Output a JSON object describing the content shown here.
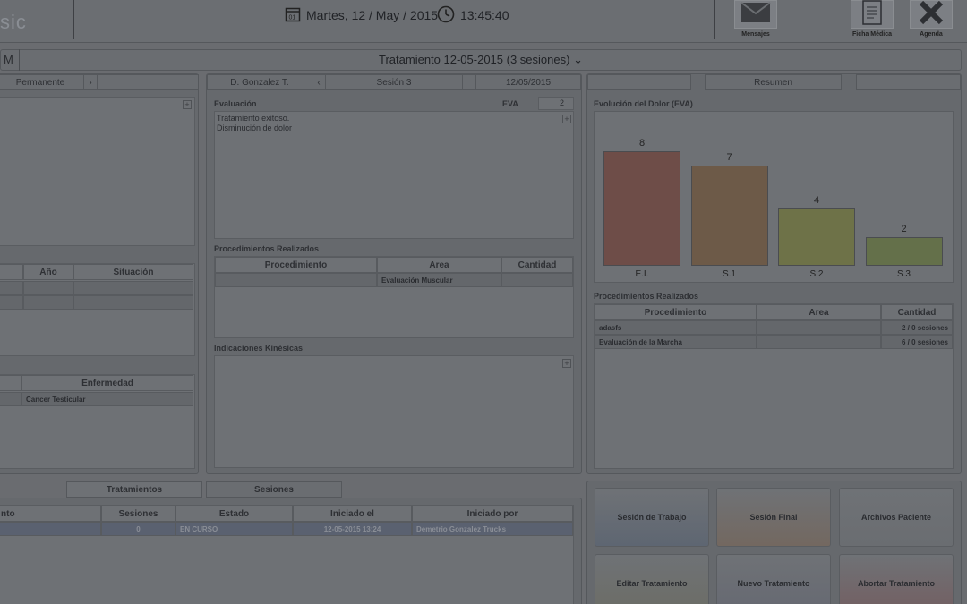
{
  "app": {
    "logo_text": "sic"
  },
  "header": {
    "date": "Martes, 12 / May / 2015",
    "time": "13:45:40",
    "buttons": [
      {
        "label": "Mensajes",
        "icon": "envelope-icon"
      },
      {
        "label": "Ficha Médica",
        "icon": "document-icon"
      },
      {
        "label": "Agenda",
        "icon": "close-x-icon"
      }
    ]
  },
  "titlebar": {
    "m_label": "M",
    "title": "Tratamiento 12-05-2015 (3 sesiones)"
  },
  "left": {
    "tab_label": "Permanente",
    "table1": {
      "headers": [
        "Año",
        "Situación"
      ]
    },
    "table2": {
      "headers": [
        "Enfermedad"
      ],
      "rows": [
        [
          "Cancer Testicular"
        ]
      ]
    }
  },
  "middle": {
    "professional": "D. Gonzalez T.",
    "session": "Sesión 3",
    "date": "12/05/2015",
    "evaluation_label": "Evaluación",
    "eva_label": "EVA",
    "eva_value": "2",
    "evaluation_text_line1": "Tratamiento exitoso.",
    "evaluation_text_line2": "Disminución de dolor",
    "procedures_label": "Procedimientos Realizados",
    "procedures_headers": [
      "Procedimiento",
      "Area",
      "Cantidad"
    ],
    "procedures_rows": [
      [
        "",
        "Evaluación Muscular",
        ""
      ]
    ],
    "indications_label": "Indicaciones Kinésicas"
  },
  "right": {
    "tab_label": "Resumen",
    "chart_title": "Evolución del Dolor (EVA)",
    "procedures_label": "Procedimientos Realizados",
    "procedures_headers": [
      "Procedimiento",
      "Area",
      "Cantidad"
    ],
    "procedures_rows": [
      [
        "adasfs",
        "",
        "2 / 0 sesiones"
      ],
      [
        "Evaluación de la Marcha",
        "",
        "6 / 0 sesiones"
      ]
    ]
  },
  "chart_data": {
    "type": "bar",
    "title": "Evolución del Dolor (EVA)",
    "categories": [
      "E.I.",
      "S.1",
      "S.2",
      "S.3"
    ],
    "values": [
      8,
      7,
      4,
      2
    ],
    "ylim": [
      0,
      10
    ],
    "colors": [
      "#6e4d48",
      "#6d5a48",
      "#6e7248",
      "#64704a"
    ]
  },
  "bottom": {
    "tabs": [
      "Tratamientos",
      "Sesiones"
    ],
    "headers": [
      "nto",
      "Sesiones",
      "Estado",
      "Iniciado el",
      "Iniciado por"
    ],
    "rows": [
      [
        "",
        "0",
        "EN CURSO",
        "12-05-2015 13:24",
        "Demetrio Gonzalez Trucks"
      ]
    ]
  },
  "actions": [
    {
      "label": "Sesión de Trabajo",
      "color": "#5e6672"
    },
    {
      "label": "Sesión Final",
      "color": "#736860"
    },
    {
      "label": "Archivos Paciente",
      "color": "#6a6d71"
    },
    {
      "label": "Editar Tratamiento",
      "color": "#6c6d66"
    },
    {
      "label": "Nuevo Tratamiento",
      "color": "#666972"
    },
    {
      "label": "Abortar Tratamiento",
      "color": "#735f62"
    }
  ]
}
